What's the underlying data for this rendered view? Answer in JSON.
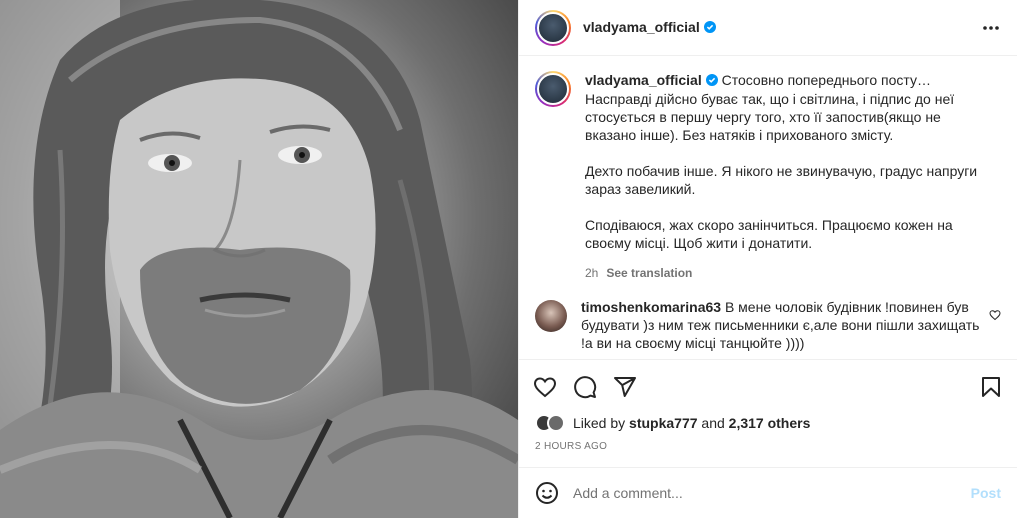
{
  "post": {
    "username": "vladyama_official",
    "verified": true,
    "more_icon": "more-horizontal-icon"
  },
  "caption": {
    "username": "vladyama_official",
    "paragraphs": [
      "Стосовно попереднього посту… Насправді дійсно буває так, що і світлина, і підпис до неї стосується в першу чергу того, хто її запостив(якщо не вказано інше). Без натяків і прихованого змісту.",
      "Дехто побачив інше. Я нікого не звинувачую, градус напруги зараз завеликий.",
      "Сподіваюся, жах скоро занінчиться. Працюємо кожен на своєму місці. Щоб жити і донатити."
    ],
    "time": "2h",
    "see_translation": "See translation"
  },
  "comment": {
    "username": "timoshenkomarina63",
    "text": "В мене чоловік будівник !повинен був будувати )з ним теж письменники є,але вони пішли захищать !а ви на своєму місці танцюйте ))))"
  },
  "actions": {
    "icons": [
      "heart-icon",
      "comment-icon",
      "share-icon",
      "bookmark-icon"
    ]
  },
  "likes": {
    "prefix": "Liked by",
    "user": "stupka777",
    "and": "and",
    "others": "2,317 others"
  },
  "timestamp": "2 HOURS AGO",
  "add_comment": {
    "placeholder": "Add a comment...",
    "post_label": "Post",
    "post_color": "#b2dffc"
  }
}
